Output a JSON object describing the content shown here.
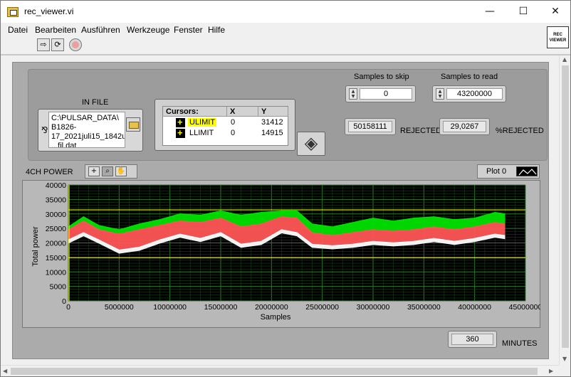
{
  "window": {
    "title": "rec_viewer.vi",
    "minimize": "—",
    "maximize": "☐",
    "close": "✕"
  },
  "menu": [
    "Datei",
    "Bearbeiten",
    "Ausführen",
    "Werkzeuge",
    "Fenster",
    "Hilfe"
  ],
  "toolbar": {
    "run_icon": "run-arrow-icon",
    "run_continuous_icon": "run-continuous-icon",
    "abort_icon": "abort-icon"
  },
  "vi_icon": {
    "line1": "REC",
    "line2": "VIEWER"
  },
  "infile": {
    "label": "IN FILE",
    "path": "C:\\PULSAR_DATA\\\nB1826-\n17_2021juli15_1842u\n...fil.dat"
  },
  "cursors": {
    "headers": [
      "Cursors:",
      "X",
      "Y"
    ],
    "rows": [
      {
        "name": "ULIMIT",
        "x": "0",
        "y": "31412",
        "highlight": "#ffff00"
      },
      {
        "name": "LLIMIT",
        "x": "0",
        "y": "14915",
        "highlight": ""
      }
    ]
  },
  "samples_to_skip": {
    "label": "Samples to skip",
    "value": "0"
  },
  "samples_to_read": {
    "label": "Samples to read",
    "value": "43200000"
  },
  "rejected": {
    "value": "50158111",
    "label": "REJECTED"
  },
  "pct_rejected": {
    "value": "29,0267",
    "label": "%REJECTED"
  },
  "graph": {
    "label": "4CH POWER",
    "legend": "Plot 0"
  },
  "minutes": {
    "value": "360",
    "label": "MINUTES"
  },
  "chart_data": {
    "type": "line",
    "title": "",
    "xlabel": "Samples",
    "ylabel": "Total power",
    "xlim": [
      0,
      45000000
    ],
    "ylim": [
      0,
      40000
    ],
    "x_ticks": [
      "0",
      "5000000",
      "10000000",
      "15000000",
      "20000000",
      "25000000",
      "30000000",
      "35000000",
      "40000000",
      "45000000"
    ],
    "y_ticks": [
      "0",
      "5000",
      "10000",
      "15000",
      "20000",
      "25000",
      "30000",
      "35000",
      "40000"
    ],
    "grid": true,
    "background": "#000000",
    "cursor_lines": [
      {
        "name": "ULIMIT",
        "y": 31412,
        "color": "#ffff00"
      },
      {
        "name": "LLIMIT",
        "y": 14915,
        "color": "#ffff00"
      }
    ],
    "x": [
      0,
      1500000,
      3000000,
      5000000,
      7000000,
      9000000,
      11000000,
      13000000,
      15000000,
      17000000,
      19000000,
      21000000,
      22500000,
      24000000,
      26000000,
      28000000,
      30000000,
      32000000,
      34000000,
      36000000,
      38000000,
      40000000,
      42000000,
      43000000
    ],
    "series": [
      {
        "color": "#00e000",
        "values": [
          25500,
          29000,
          26000,
          24500,
          26500,
          28000,
          30000,
          29500,
          31000,
          29500,
          30500,
          31000,
          31000,
          26500,
          25500,
          27000,
          28500,
          27500,
          28500,
          29000,
          28000,
          28500,
          30500,
          30000
        ]
      },
      {
        "color": "#ff5555",
        "values": [
          24500,
          27500,
          24500,
          23000,
          24500,
          26000,
          27500,
          27000,
          28500,
          25500,
          26500,
          29000,
          28500,
          23500,
          22500,
          23500,
          24500,
          24000,
          24500,
          25500,
          24500,
          25500,
          27000,
          26500
        ]
      },
      {
        "color": "#ffffff",
        "values": [
          21000,
          23500,
          21000,
          17500,
          18500,
          21000,
          23000,
          21500,
          23500,
          19500,
          20500,
          24500,
          23500,
          19500,
          19000,
          19500,
          20500,
          20000,
          20500,
          21500,
          20500,
          21500,
          23000,
          22500
        ]
      }
    ]
  }
}
